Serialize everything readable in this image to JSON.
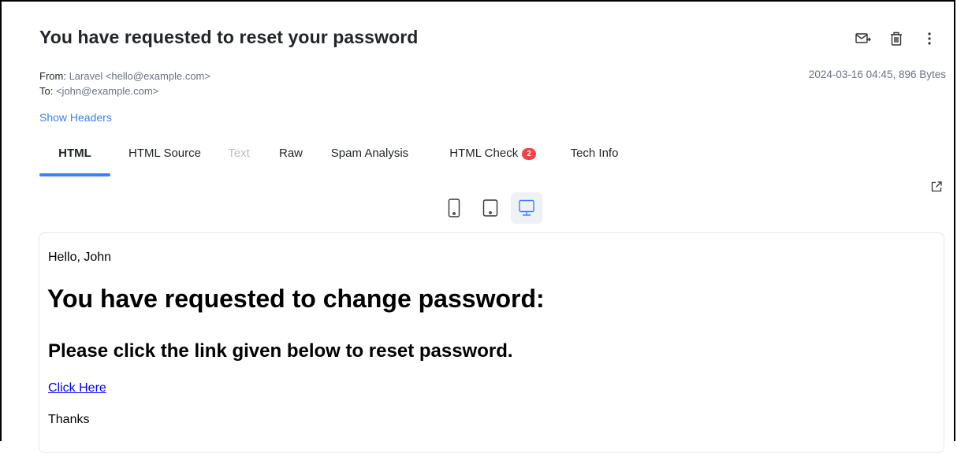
{
  "email": {
    "subject": "You have requested to reset your password",
    "from_label": "From:",
    "from_value": "Laravel <hello@example.com>",
    "to_label": "To:",
    "to_value": "<john@example.com>",
    "meta_right": "2024-03-16 04:45, 896 Bytes",
    "show_headers": "Show Headers"
  },
  "actions": {
    "icons": [
      "forward-mail-icon",
      "trash-icon",
      "more-vertical-icon"
    ]
  },
  "tabs": [
    {
      "label": "HTML",
      "state": "active"
    },
    {
      "label": "HTML Source",
      "state": "normal"
    },
    {
      "label": "Text",
      "state": "disabled"
    },
    {
      "label": "Raw",
      "state": "normal"
    },
    {
      "label": "Spam Analysis",
      "state": "normal"
    },
    {
      "label": "HTML Check",
      "state": "normal",
      "badge": "2"
    },
    {
      "label": "Tech Info",
      "state": "normal"
    }
  ],
  "devices": {
    "options": [
      "phone",
      "tablet",
      "desktop"
    ],
    "selected": "desktop"
  },
  "body": {
    "greeting": "Hello, John",
    "heading": "You have requested to change password:",
    "subheading": "Please click the link given below to reset password.",
    "link_text": "Click Here",
    "thanks": "Thanks"
  },
  "colors": {
    "accent": "#3b82f6",
    "badge": "#ef4444",
    "link": "#0000ee"
  }
}
